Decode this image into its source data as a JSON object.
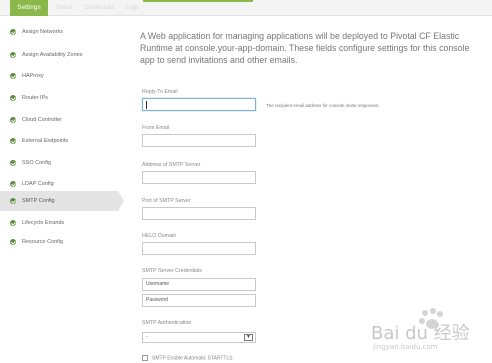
{
  "tabs": [
    {
      "label": "Settings",
      "active": true
    },
    {
      "label": "Status",
      "active": false
    },
    {
      "label": "Credentials",
      "active": false
    },
    {
      "label": "Logs",
      "active": false
    }
  ],
  "sidebar": {
    "items": [
      {
        "label": "Assign Networks"
      },
      {
        "label": "Assign Availability Zones"
      },
      {
        "label": "HAProxy"
      },
      {
        "label": "Router IPs"
      },
      {
        "label": "Cloud Controller"
      },
      {
        "label": "External Endpoints"
      },
      {
        "label": "SSO Config"
      },
      {
        "label": "LDAP Config"
      },
      {
        "label": "SMTP Config",
        "active": true
      },
      {
        "label": "Lifecycle Errands"
      },
      {
        "label": "Resource Config"
      }
    ]
  },
  "intro": "A Web application for managing applications will be deployed to Pivotal CF Elastic Runtime at console.your-app-domain. These fields configure settings for this console app to send invitations and other emails.",
  "form": {
    "reply_to_label": "Reply-To Email",
    "reply_to_hint": "The recipient email address for console invite responses.",
    "from_email_label": "From Email",
    "smtp_address_label": "Address of SMTP Server",
    "smtp_port_label": "Port of SMTP Server",
    "helo_label": "HELO Domain",
    "credentials_label": "SMTP Server Credentials",
    "username_value": "Username",
    "password_value": "Password",
    "auth_label": "SMTP Authentication",
    "auth_value": "-",
    "starttls_label": "SMTP Enable Automatic STARTTLS"
  },
  "watermark": {
    "text": "Bai du 经验",
    "sub": "jingyan.baidu.com"
  }
}
